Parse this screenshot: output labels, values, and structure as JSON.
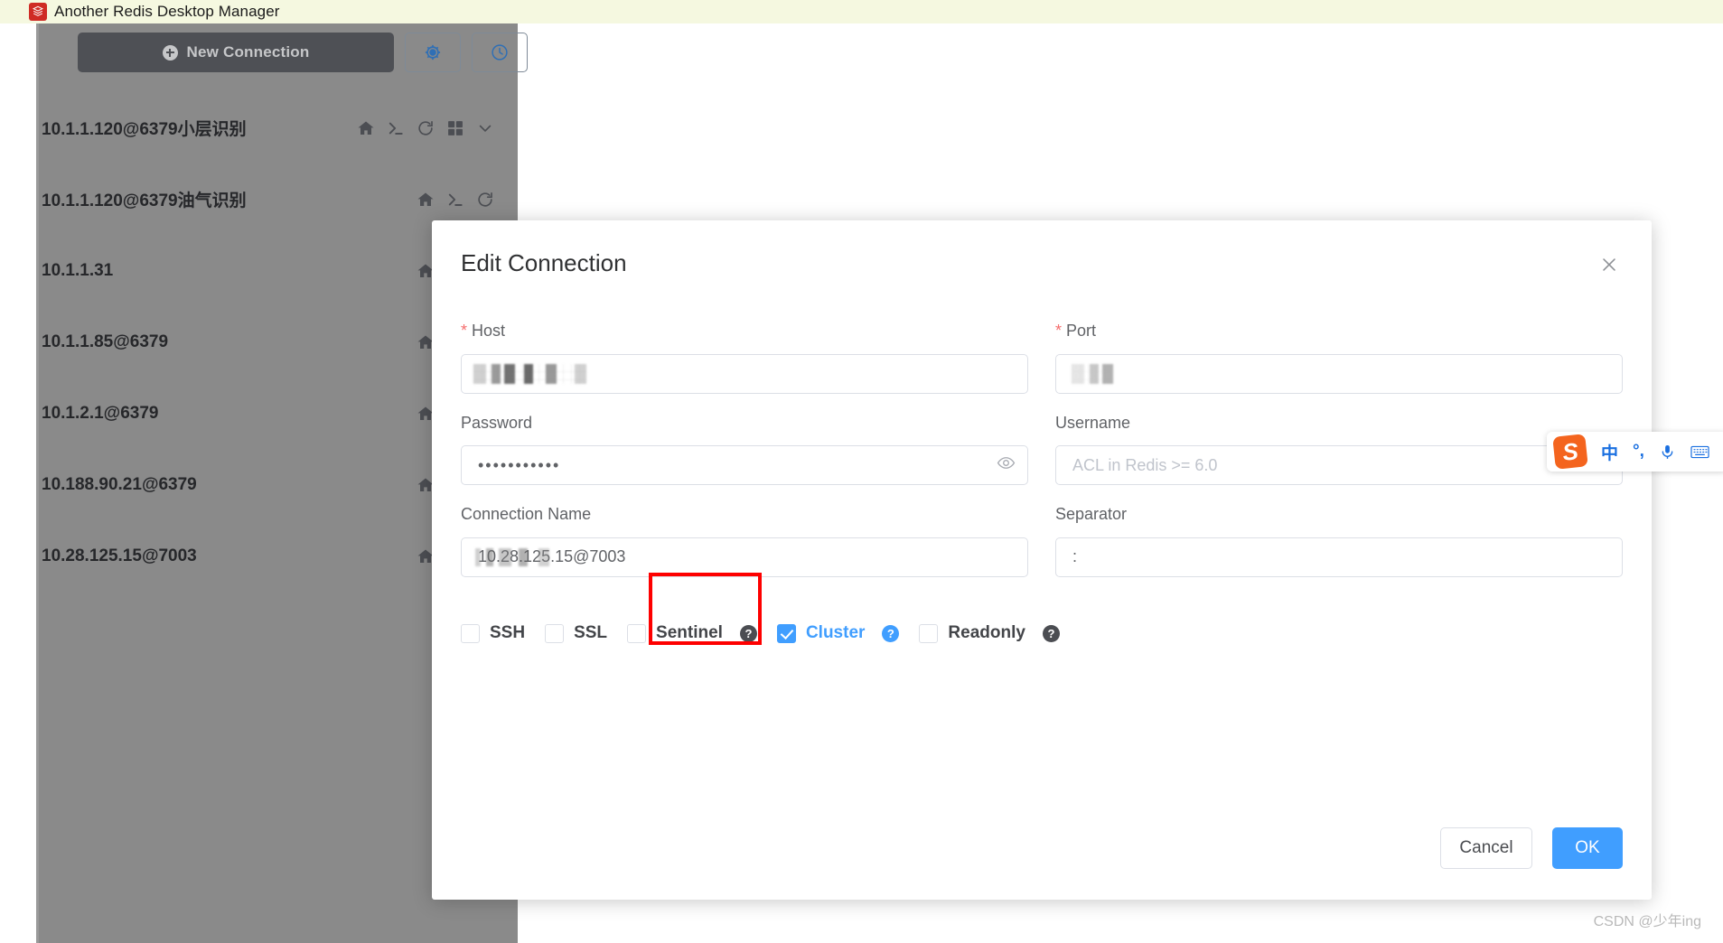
{
  "window": {
    "title": "Another Redis Desktop Manager",
    "icon": "redis-logo-icon"
  },
  "toolbar": {
    "new_connection_label": "New Connection",
    "settings_icon": "gear-icon",
    "history_icon": "clock-icon"
  },
  "sidebar": {
    "connections": [
      {
        "name": "10.1.1.120@6379小层识别",
        "has_dropdown": true
      },
      {
        "name": "10.1.1.120@6379油气识别",
        "has_dropdown": false
      },
      {
        "name": "10.1.1.31",
        "has_dropdown": false
      },
      {
        "name": "10.1.1.85@6379",
        "has_dropdown": false
      },
      {
        "name": "10.1.2.1@6379",
        "has_dropdown": false
      },
      {
        "name": "10.188.90.21@6379",
        "has_dropdown": false
      },
      {
        "name": "10.28.125.15@7003",
        "has_dropdown": false
      }
    ],
    "row_action_icons": [
      "home-icon",
      "terminal-icon",
      "refresh-icon",
      "grid-icon",
      "chevron-down-icon"
    ]
  },
  "dialog": {
    "title": "Edit Connection",
    "close_icon": "close-icon",
    "fields": {
      "host": {
        "label": "Host",
        "required": true,
        "value": "",
        "masked": true,
        "placeholder": ""
      },
      "port": {
        "label": "Port",
        "required": true,
        "value": "",
        "masked": true,
        "placeholder": ""
      },
      "password": {
        "label": "Password",
        "required": false,
        "value": "•••••••••••",
        "placeholder": "",
        "reveal_icon": "eye-icon"
      },
      "username": {
        "label": "Username",
        "required": false,
        "value": "",
        "placeholder": "ACL in Redis >= 6.0"
      },
      "connection_name": {
        "label": "Connection Name",
        "required": false,
        "value": "10.28.125.15@7003",
        "partially_masked": true,
        "placeholder": ""
      },
      "separator": {
        "label": "Separator",
        "required": false,
        "value": ":",
        "placeholder": ""
      }
    },
    "checkboxes": [
      {
        "label": "SSH",
        "checked": false,
        "help": false
      },
      {
        "label": "SSL",
        "checked": false,
        "help": false
      },
      {
        "label": "Sentinel",
        "checked": false,
        "help": true,
        "help_icon": "question-mark-icon"
      },
      {
        "label": "Cluster",
        "checked": true,
        "help": true,
        "help_icon": "question-mark-icon",
        "highlighted": true
      },
      {
        "label": "Readonly",
        "checked": false,
        "help": true,
        "help_icon": "question-mark-icon"
      }
    ],
    "buttons": {
      "cancel": "Cancel",
      "ok": "OK"
    }
  },
  "ime": {
    "logo": "sogou-s-logo",
    "mode_label": "中",
    "punctuation_label": "°,",
    "mic_icon": "microphone-icon",
    "keyboard_icon": "keyboard-icon"
  },
  "watermark": "CSDN @少年ing",
  "colors": {
    "accent": "#409eff",
    "highlight_box": "#fe0000",
    "titlebar_bg": "#f5f8e0",
    "sidebar_bg": "#8a8a8a",
    "required_star": "#f56c6c",
    "ime_orange": "#f4641e"
  }
}
